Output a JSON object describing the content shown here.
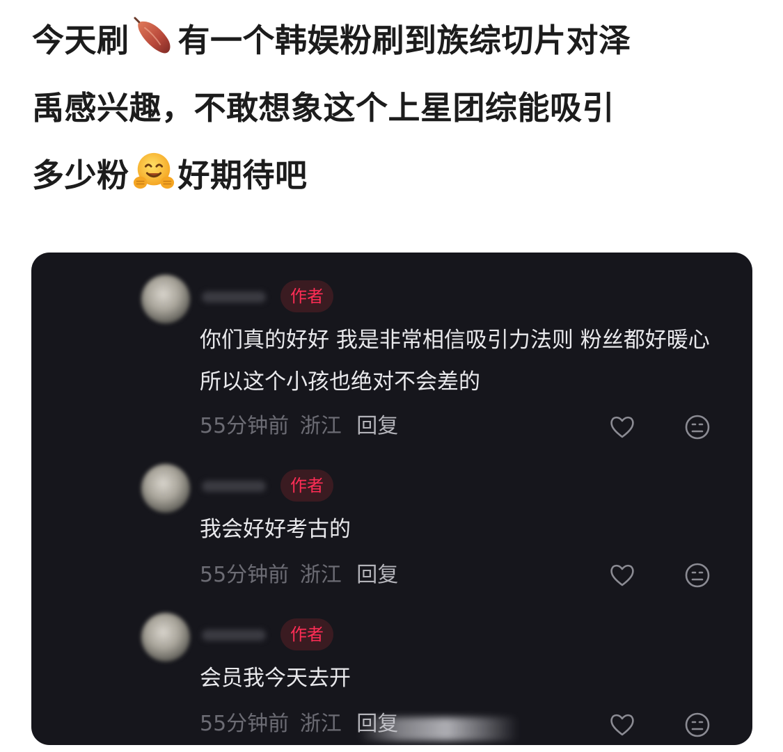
{
  "post": {
    "line1_before": "今天刷",
    "line1_after": "有一个韩娱粉刷到族综切片对泽",
    "line2": "禹感兴趣，不敢想象这个上星团综能吸引",
    "line3_before": "多少粉",
    "line3_after": "好期待吧",
    "emoji_1": "sweet-potato-icon",
    "emoji_2": "hugging-face-icon"
  },
  "colors": {
    "card_bg": "#16161c",
    "author_badge": "#ff2d55",
    "comment_text": "#e9e9ec",
    "meta_text": "#6c6c74"
  },
  "comments": [
    {
      "badge": "作者",
      "text": "你们真的好好 我是非常相信吸引力法则 粉丝都好暖心 所以这个小孩也绝对不会差的",
      "time": "55分钟前",
      "location": "浙江",
      "reply": "回复"
    },
    {
      "badge": "作者",
      "text": "我会好好考古的",
      "time": "55分钟前",
      "location": "浙江",
      "reply": "回复"
    },
    {
      "badge": "作者",
      "text": "会员我今天去开",
      "time": "55分钟前",
      "location": "浙江",
      "reply": "回复"
    }
  ]
}
